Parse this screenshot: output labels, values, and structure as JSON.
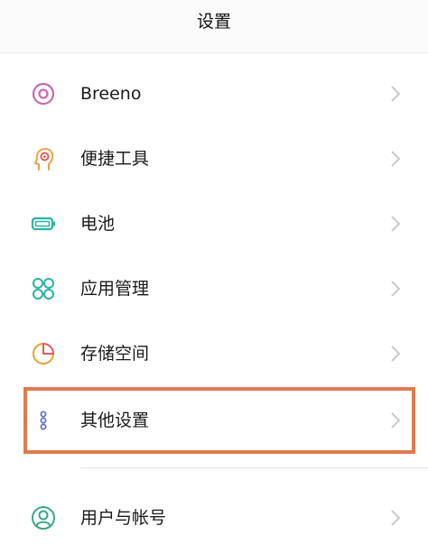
{
  "header": {
    "title": "设置"
  },
  "colors": {
    "breeno": "#c569b3",
    "tools": "#e9a447",
    "battery": "#2bb3a3",
    "apps": "#2bb3a3",
    "storage": "#e2aa3f",
    "storage_accent": "#e25a5a",
    "other": "#6673c2",
    "user": "#3aa68b",
    "highlight": "#e07a4f"
  },
  "items": [
    {
      "label": "Breeno",
      "icon": "breeno-icon"
    },
    {
      "label": "便捷工具",
      "icon": "head-icon"
    },
    {
      "label": "电池",
      "icon": "battery-icon"
    },
    {
      "label": "应用管理",
      "icon": "apps-icon"
    },
    {
      "label": "存储空间",
      "icon": "storage-icon"
    },
    {
      "label": "其他设置",
      "icon": "dots-icon"
    },
    {
      "label": "用户与帐号",
      "icon": "user-icon"
    }
  ]
}
